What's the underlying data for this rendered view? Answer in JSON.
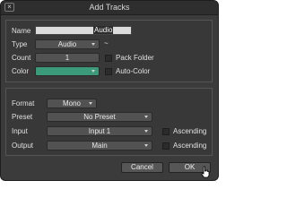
{
  "window": {
    "title": "Add Tracks",
    "close_glyph": "×"
  },
  "track": {
    "name_label": "Name",
    "name_value": "Audio",
    "type_label": "Type",
    "type_value": "Audio",
    "type_extra": "~",
    "count_label": "Count",
    "count_value": "1",
    "pack_folder_label": "Pack Folder",
    "pack_folder_checked": false,
    "color_label": "Color",
    "color_value": "#3a9a7a",
    "auto_color_label": "Auto-Color",
    "auto_color_checked": false
  },
  "routing": {
    "format_label": "Format",
    "format_value": "Mono",
    "preset_label": "Preset",
    "preset_value": "No Preset",
    "input_label": "Input",
    "input_value": "Input 1",
    "input_ascending_label": "Ascending",
    "input_ascending_checked": false,
    "output_label": "Output",
    "output_value": "Main",
    "output_ascending_label": "Ascending",
    "output_ascending_checked": false
  },
  "buttons": {
    "cancel_label": "Cancel",
    "ok_label": "OK"
  },
  "icons": {
    "cursor": "pointer-hand-icon"
  }
}
